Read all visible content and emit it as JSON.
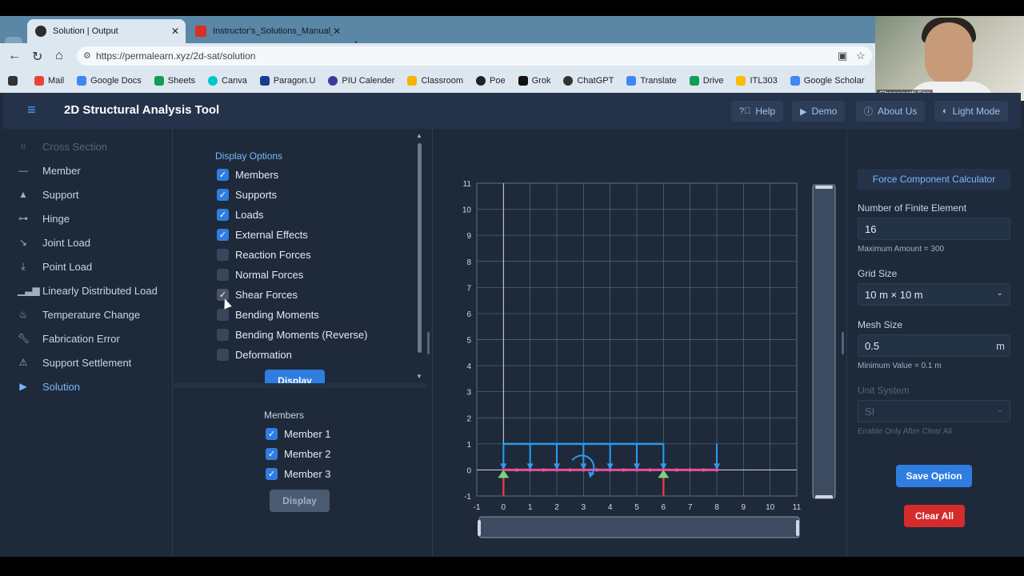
{
  "browser": {
    "tabs": [
      {
        "label": "Solution | Output",
        "active": true
      },
      {
        "label": "Instructor's_Solutions_Manual_for",
        "active": false
      }
    ],
    "url": "https://permalearn.xyz/2d-sat/solution",
    "bookmarks": [
      {
        "label": "Mail",
        "color": "#ea4335"
      },
      {
        "label": "Google Docs",
        "color": "#4285f4"
      },
      {
        "label": "Sheets",
        "color": "#0f9d58"
      },
      {
        "label": "Canva",
        "color": "#00c4cc"
      },
      {
        "label": "Paragon.U",
        "color": "#1a3d8f"
      },
      {
        "label": "PIU Calender",
        "color": "#3b3b9f"
      },
      {
        "label": "Classroom",
        "color": "#f4b400"
      },
      {
        "label": "Poe",
        "color": "#222222"
      },
      {
        "label": "Grok",
        "color": "#111111"
      },
      {
        "label": "ChatGPT",
        "color": "#333333"
      },
      {
        "label": "Translate",
        "color": "#4285f4"
      },
      {
        "label": "Drive",
        "color": "#0f9d58"
      },
      {
        "label": "ITL303",
        "color": "#fbbc05"
      },
      {
        "label": "Google Scholar",
        "color": "#4285f4"
      }
    ],
    "webcam_name": "Chanpiseth Son"
  },
  "header": {
    "title": "2D Structural Analysis Tool",
    "buttons": [
      {
        "label": "Help",
        "icon": "question-circle-icon"
      },
      {
        "label": "Demo",
        "icon": "play-circle-icon"
      },
      {
        "label": "About Us",
        "icon": "info-circle-icon"
      },
      {
        "label": "Light Mode",
        "icon": "contrast-icon"
      }
    ]
  },
  "sidebar": {
    "items": [
      {
        "label": "Cross Section",
        "icon": "cross-section-icon",
        "state": "disabled"
      },
      {
        "label": "Member",
        "icon": "member-line-icon",
        "state": "normal"
      },
      {
        "label": "Support",
        "icon": "support-triangle-icon",
        "state": "normal"
      },
      {
        "label": "Hinge",
        "icon": "hinge-icon",
        "state": "normal"
      },
      {
        "label": "Joint Load",
        "icon": "joint-load-icon",
        "state": "normal"
      },
      {
        "label": "Point Load",
        "icon": "point-load-icon",
        "state": "normal"
      },
      {
        "label": "Linearly Distributed Load",
        "icon": "distributed-load-icon",
        "state": "normal"
      },
      {
        "label": "Temperature Change",
        "icon": "temperature-icon",
        "state": "normal"
      },
      {
        "label": "Fabrication Error",
        "icon": "wrench-icon",
        "state": "normal"
      },
      {
        "label": "Support Settlement",
        "icon": "warning-triangle-icon",
        "state": "normal"
      },
      {
        "label": "Solution",
        "icon": "play-icon",
        "state": "active"
      }
    ]
  },
  "display_options": {
    "title": "Display Options",
    "options": [
      {
        "label": "Members",
        "checked": true
      },
      {
        "label": "Supports",
        "checked": true
      },
      {
        "label": "Loads",
        "checked": true
      },
      {
        "label": "External Effects",
        "checked": true
      },
      {
        "label": "Reaction Forces",
        "checked": false
      },
      {
        "label": "Normal Forces",
        "checked": false
      },
      {
        "label": "Shear Forces",
        "checked": true
      },
      {
        "label": "Bending Moments",
        "checked": false
      },
      {
        "label": "Bending Moments (Reverse)",
        "checked": false
      },
      {
        "label": "Deformation",
        "checked": false
      }
    ],
    "display_label": "Display"
  },
  "members_panel": {
    "title": "Members",
    "members": [
      {
        "label": "Member 1",
        "checked": true
      },
      {
        "label": "Member 2",
        "checked": true
      },
      {
        "label": "Member 3",
        "checked": true
      }
    ],
    "display_label": "Display"
  },
  "settings": {
    "calculator_label": "Force Component Calculator",
    "fe_label": "Number of Finite Element",
    "fe_value": "16",
    "fe_hint": "Maximum Amount = 300",
    "grid_label": "Grid Size",
    "grid_value": "10 m × 10 m",
    "mesh_label": "Mesh Size",
    "mesh_value": "0.5",
    "mesh_unit": "m",
    "mesh_hint": "Minimum Value = 0.1 m",
    "unit_label": "Unit System",
    "unit_value": "SI",
    "unit_hint": "Enable Only After Clear All",
    "save_label": "Save Option",
    "clear_label": "Clear All"
  },
  "chart_data": {
    "type": "scatter",
    "x_ticks": [
      "-1",
      "0",
      "1",
      "2",
      "3",
      "4",
      "5",
      "6",
      "7",
      "8",
      "9",
      "10",
      "11"
    ],
    "y_ticks": [
      "-1",
      "0",
      "1",
      "2",
      "3",
      "4",
      "5",
      "6",
      "7",
      "8",
      "9",
      "10",
      "11"
    ],
    "xlim": [
      -1,
      11
    ],
    "ylim": [
      -1,
      11
    ],
    "grid": true,
    "beam": {
      "x_start": 0,
      "x_end": 8,
      "y": 0
    },
    "supports_x": [
      0,
      6
    ],
    "distributed_load": {
      "x_start": 0,
      "x_end": 8,
      "top_y": 1,
      "arrow_x": [
        0,
        1,
        2,
        3,
        4,
        5,
        6,
        8
      ]
    },
    "moment_at_x": 3,
    "colors": {
      "beam": "#e94fa0",
      "load": "#2d9bf0",
      "support": "#7ed37a",
      "reaction": "#e03b3b",
      "grid": "#5a6a80",
      "axis": "#d0d8e3"
    }
  }
}
